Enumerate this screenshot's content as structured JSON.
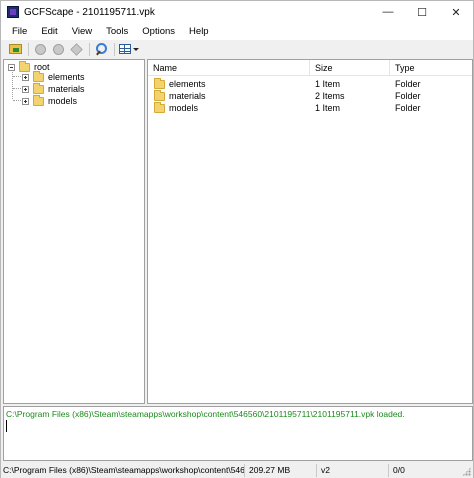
{
  "window": {
    "title": "GCFScape - 2101195711.vpk",
    "controls": {
      "minimize": "—",
      "maximize": "☐",
      "close": "✕"
    }
  },
  "menu": [
    "File",
    "Edit",
    "View",
    "Tools",
    "Options",
    "Help"
  ],
  "toolbar": {
    "icons": [
      "open-icon",
      "back-icon",
      "forward-icon",
      "extract-icon",
      "find-icon",
      "view-mode-icon"
    ]
  },
  "tree": {
    "root": "root",
    "children": [
      "elements",
      "materials",
      "models"
    ]
  },
  "list": {
    "columns": [
      "Name",
      "Size",
      "Type"
    ],
    "rows": [
      {
        "name": "elements",
        "size": "1 Item",
        "type": "Folder"
      },
      {
        "name": "materials",
        "size": "2 Items",
        "type": "Folder"
      },
      {
        "name": "models",
        "size": "1 Item",
        "type": "Folder"
      }
    ]
  },
  "log": {
    "line": "C:\\Program Files (x86)\\Steam\\steamapps\\workshop\\content\\546560\\2101195711\\2101195711.vpk loaded.",
    "color": "#1a8a1a"
  },
  "status": {
    "path": "C:\\Program Files (x86)\\Steam\\steamapps\\workshop\\content\\546560\\2",
    "size": "209.27 MB",
    "version": "v2",
    "count": "0/0"
  }
}
